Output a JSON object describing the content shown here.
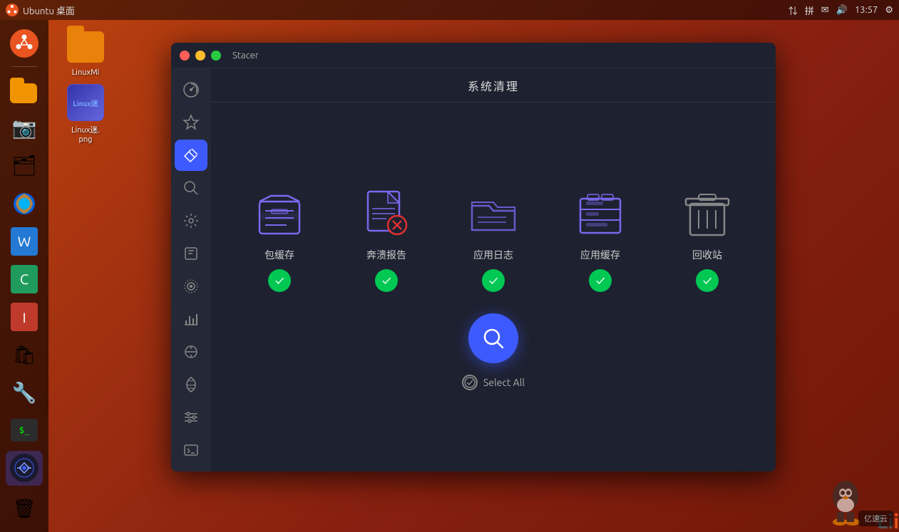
{
  "topbar": {
    "title": "Ubuntu 桌面",
    "time": "13:57",
    "icons": [
      "🔊",
      "拼",
      "✉",
      "📶"
    ]
  },
  "desktop_icons": [
    {
      "id": "linuxmi-folder",
      "label": "LinuxMi",
      "type": "folder"
    },
    {
      "id": "linuxmi-png",
      "label": "Linux迷.\npng",
      "type": "image"
    }
  ],
  "stacer_window": {
    "title": "Stacer",
    "page_title": "系统清理",
    "sidebar_items": [
      {
        "id": "dashboard",
        "icon": "⊙",
        "active": false
      },
      {
        "id": "startup",
        "icon": "🚀",
        "active": false
      },
      {
        "id": "cleaner",
        "icon": "🧹",
        "active": true
      },
      {
        "id": "search",
        "icon": "🔍",
        "active": false
      },
      {
        "id": "services",
        "icon": "⚙",
        "active": false
      },
      {
        "id": "uninstaller",
        "icon": "📦",
        "active": false
      },
      {
        "id": "resources",
        "icon": "👁",
        "active": false
      },
      {
        "id": "stats",
        "icon": "📊",
        "active": false
      },
      {
        "id": "apt",
        "icon": "🔧",
        "active": false
      },
      {
        "id": "gnome",
        "icon": "🐾",
        "active": false
      },
      {
        "id": "settings2",
        "icon": "🎛",
        "active": false
      },
      {
        "id": "terminal",
        "icon": "💬",
        "active": false
      }
    ],
    "clean_items": [
      {
        "id": "package-cache",
        "label": "包缓存",
        "checked": true
      },
      {
        "id": "crash-reports",
        "label": "奔溃报告",
        "checked": true
      },
      {
        "id": "app-logs",
        "label": "应用日志",
        "checked": true
      },
      {
        "id": "app-cache",
        "label": "应用缓存",
        "checked": true
      },
      {
        "id": "trash",
        "label": "回收站",
        "checked": true
      }
    ],
    "search_button_label": "扫描",
    "select_all_label": "Select All"
  },
  "dock_items": [
    {
      "id": "ubuntu",
      "icon": "🐧",
      "label": "",
      "type": "logo"
    },
    {
      "id": "files",
      "icon": "📁",
      "label": ""
    },
    {
      "id": "camera",
      "icon": "📷",
      "label": ""
    },
    {
      "id": "documents",
      "icon": "🗂",
      "label": ""
    },
    {
      "id": "firefox",
      "icon": "🦊",
      "label": ""
    },
    {
      "id": "libreoffice",
      "icon": "📝",
      "label": ""
    },
    {
      "id": "calc",
      "icon": "📊",
      "label": ""
    },
    {
      "id": "impress",
      "icon": "📋",
      "label": ""
    },
    {
      "id": "software",
      "icon": "📦",
      "label": ""
    },
    {
      "id": "settings",
      "icon": "🔧",
      "label": ""
    },
    {
      "id": "terminal",
      "icon": "🖥",
      "label": ""
    },
    {
      "id": "stacer",
      "icon": "⚡",
      "label": ""
    },
    {
      "id": "trash",
      "icon": "🗑",
      "label": ""
    }
  ]
}
